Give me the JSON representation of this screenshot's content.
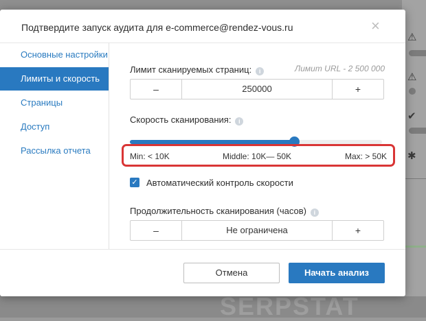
{
  "modal": {
    "title": "Подтвердите запуск аудита для e-commerce@rendez-vous.ru",
    "close_icon": "×"
  },
  "sidebar": {
    "items": [
      {
        "label": "Основные настройки",
        "active": false
      },
      {
        "label": "Лимиты и скорость",
        "active": true
      },
      {
        "label": "Страницы",
        "active": false
      },
      {
        "label": "Доступ",
        "active": false
      },
      {
        "label": "Рассылка отчета",
        "active": false
      }
    ]
  },
  "limits": {
    "label": "Лимит сканируемых страниц:",
    "note": "Лимит URL - 2 500 000",
    "minus": "–",
    "value": "250000",
    "plus": "+"
  },
  "speed": {
    "label": "Скорость сканирования:",
    "slider_value": 0.65,
    "min_label": "Min: < 10K",
    "middle_label": "Middle: 10K— 50K",
    "max_label": "Max: > 50K"
  },
  "auto_control": {
    "checked": true,
    "label": "Автоматический контроль скорости"
  },
  "duration": {
    "label": "Продолжительность сканирования (часов)",
    "minus": "–",
    "value": "Не ограничена",
    "plus": "+"
  },
  "footer": {
    "cancel_label": "Отмена",
    "start_label": "Начать анализ"
  },
  "background": {
    "watermark": "SERPSTAT"
  },
  "colors": {
    "accent": "#2979c0",
    "highlight": "#d93535"
  }
}
